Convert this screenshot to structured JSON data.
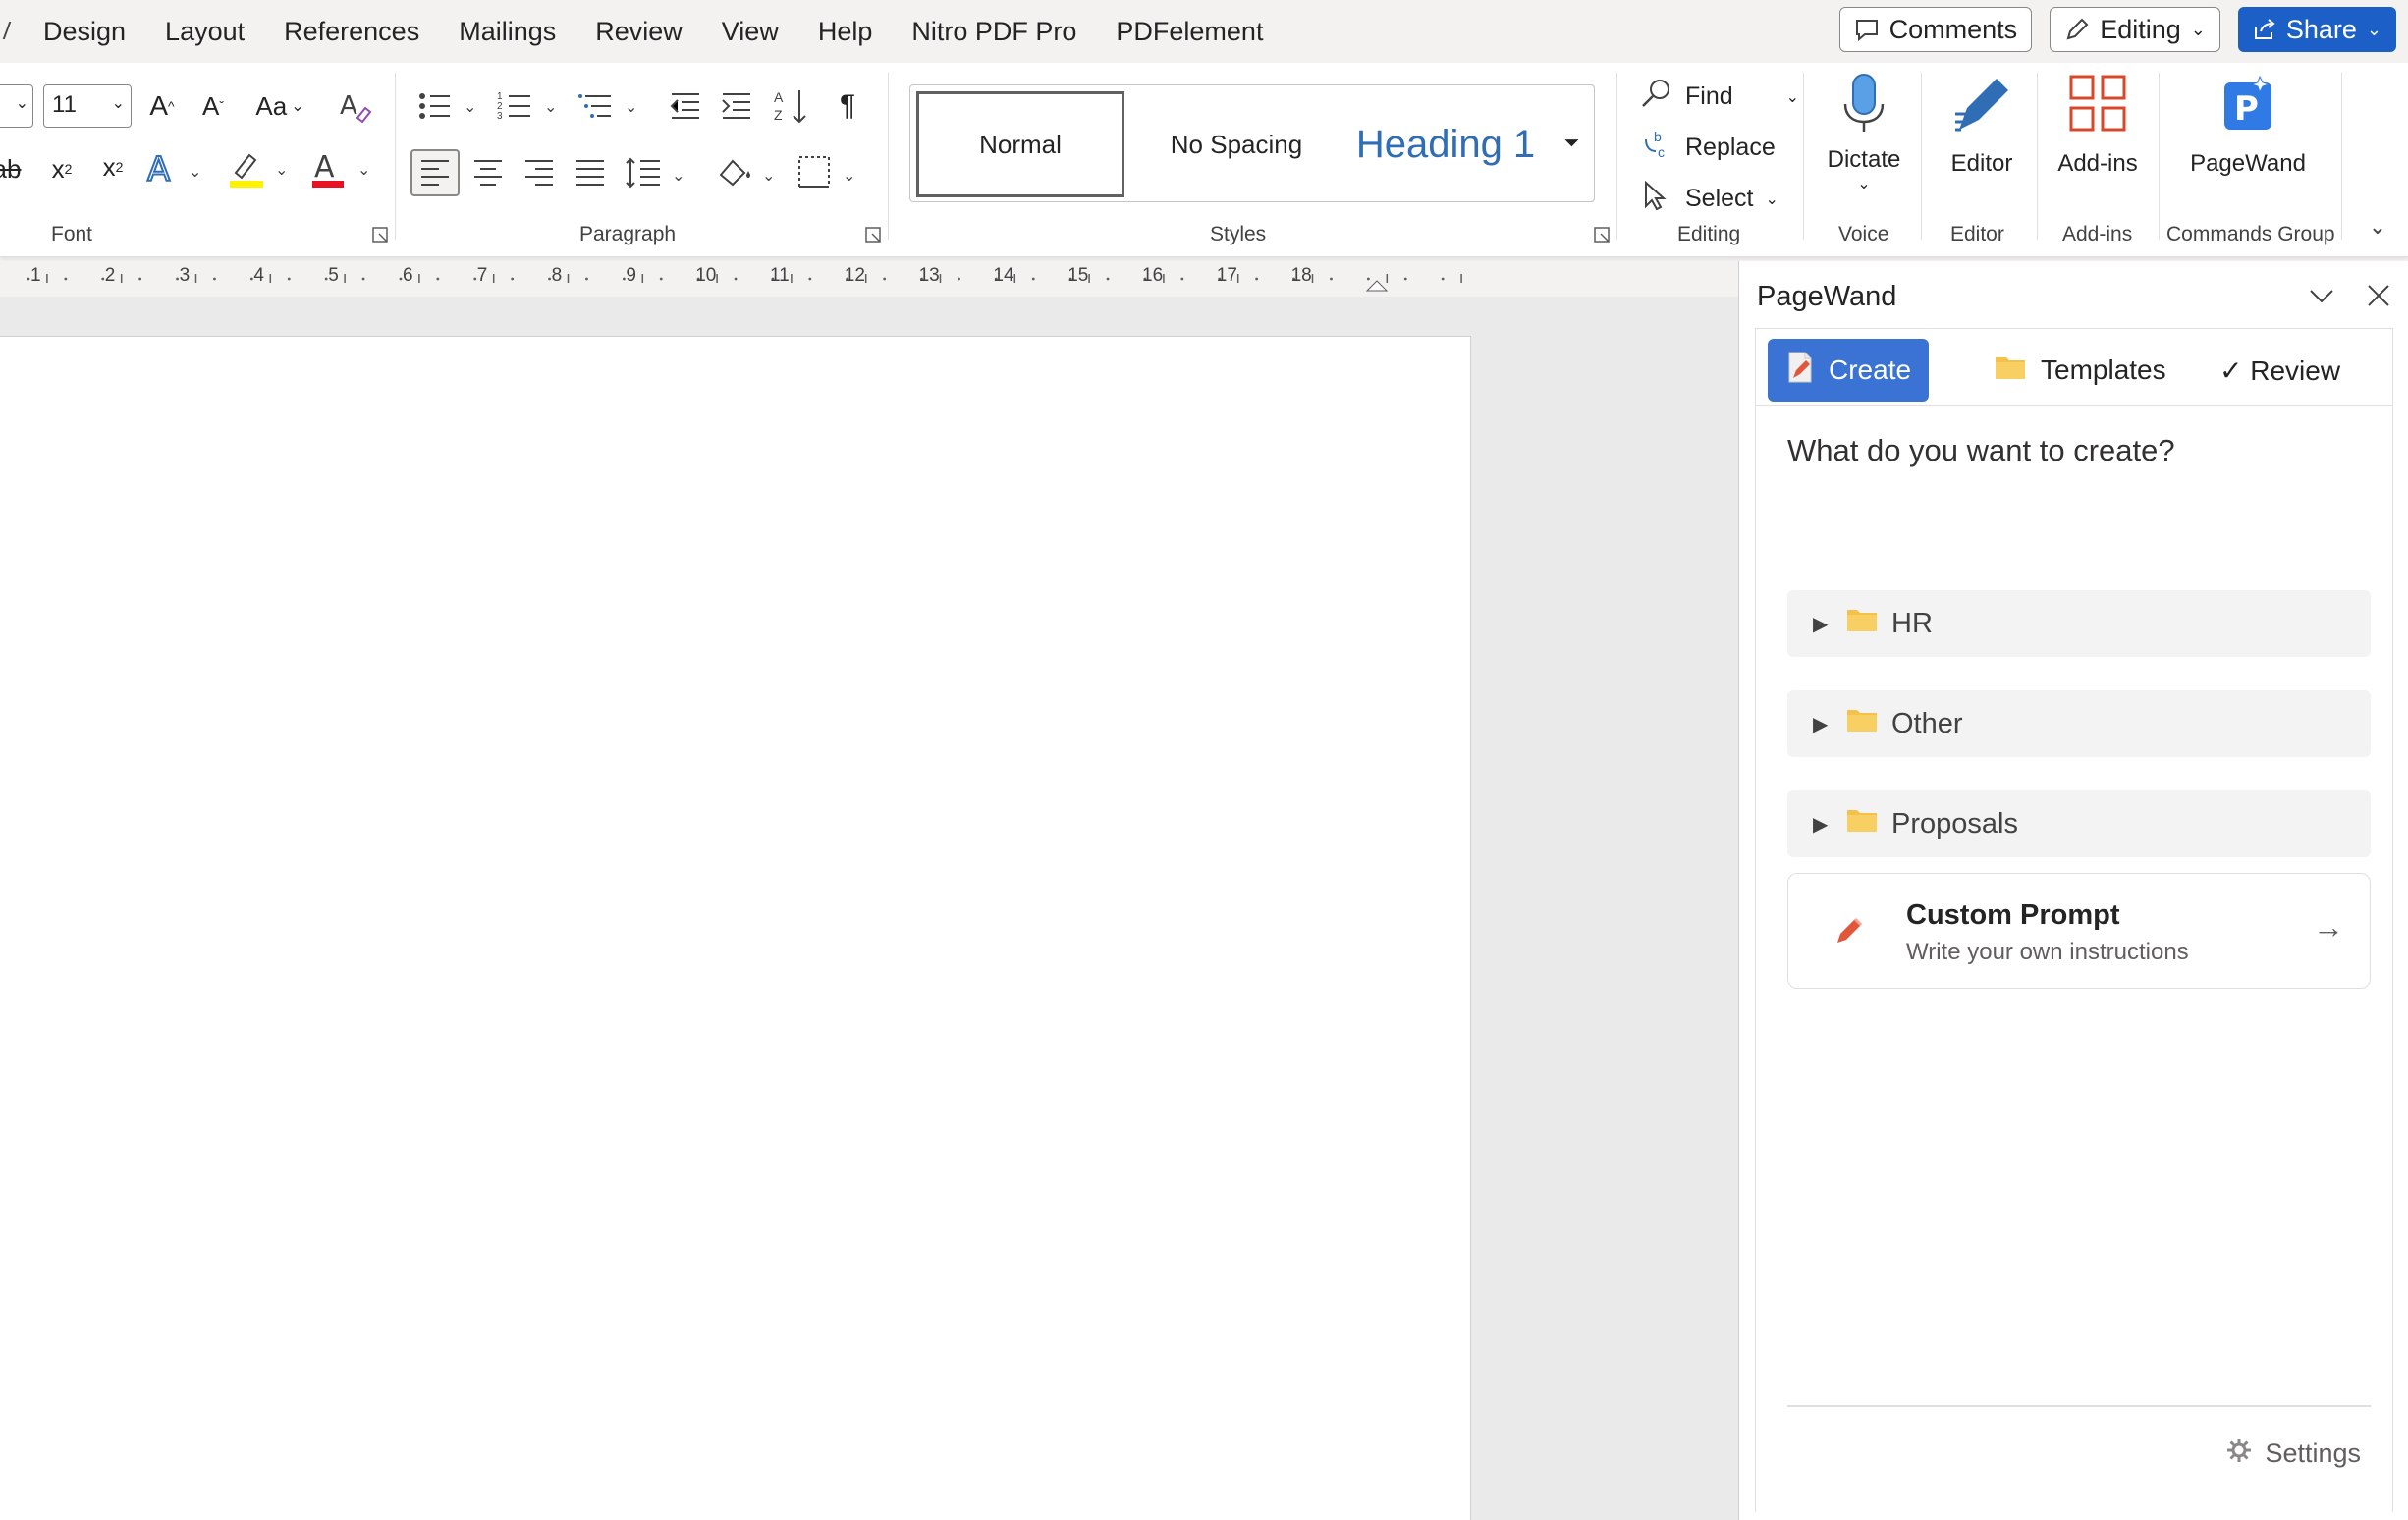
{
  "menu": {
    "tabs": [
      "Design",
      "Layout",
      "References",
      "Mailings",
      "Review",
      "View",
      "Help",
      "Nitro PDF Pro",
      "PDFelement"
    ],
    "comments_label": "Comments",
    "editing_label": "Editing",
    "share_label": "Share"
  },
  "ribbon": {
    "font": {
      "size_value": "11",
      "group_label": "Font"
    },
    "paragraph": {
      "group_label": "Paragraph"
    },
    "styles": {
      "normal": "Normal",
      "no_spacing": "No Spacing",
      "heading1": "Heading 1",
      "group_label": "Styles"
    },
    "editing": {
      "find": "Find",
      "replace": "Replace",
      "select": "Select",
      "group_label": "Editing"
    },
    "voice": {
      "dictate": "Dictate",
      "group_label": "Voice"
    },
    "editor": {
      "button": "Editor",
      "group_label": "Editor"
    },
    "addins": {
      "button": "Add-ins",
      "group_label": "Add-ins"
    },
    "pagewand": {
      "button": "PageWand",
      "group_label": "Commands Group"
    }
  },
  "ruler": {
    "ticks": [
      "1",
      "2",
      "3",
      "4",
      "5",
      "6",
      "7",
      "8",
      "9",
      "10",
      "11",
      "12",
      "13",
      "14",
      "15",
      "16",
      "17",
      "18"
    ]
  },
  "pane": {
    "title": "PageWand",
    "tabs": {
      "create": "Create",
      "templates": "Templates",
      "review": "✓ Review"
    },
    "question": "What do you want to create?",
    "folders": [
      "HR",
      "Other",
      "Proposals"
    ],
    "custom": {
      "title": "Custom Prompt",
      "subtitle": "Write your own instructions"
    },
    "settings_label": "Settings"
  },
  "colors": {
    "accent": "#1b5fc7",
    "pagewand_tab": "#3a73d4",
    "folder": "#f4c14b",
    "heading_blue": "#2f6db5",
    "addins_red": "#d9472b"
  }
}
